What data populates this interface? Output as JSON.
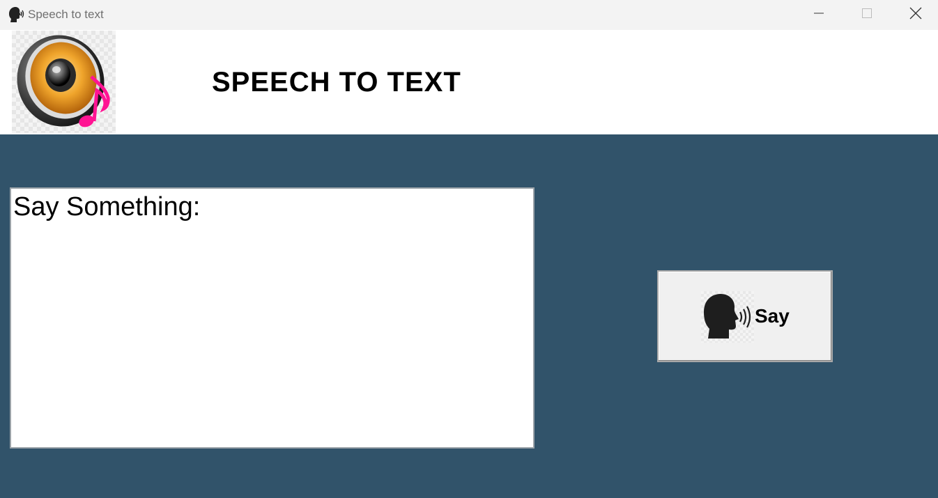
{
  "window": {
    "title": "Speech to text",
    "title_icon": "speaking-head-icon",
    "controls": {
      "minimize_icon": "minimize-icon",
      "maximize_icon": "maximize-icon",
      "close_icon": "close-icon"
    }
  },
  "header": {
    "logo_icon": "speaker-music-note-icon",
    "title": "SPEECH TO TEXT"
  },
  "main": {
    "text_area": {
      "value": "Say Something:"
    },
    "say_button": {
      "icon": "speaking-head-icon",
      "label": "Say"
    }
  },
  "colors": {
    "background": "#31536a",
    "header_background": "#ffffff",
    "titlebar_background": "#f3f3f3",
    "note_accent": "#ff1493",
    "speaker_orange": "#e8871e"
  }
}
